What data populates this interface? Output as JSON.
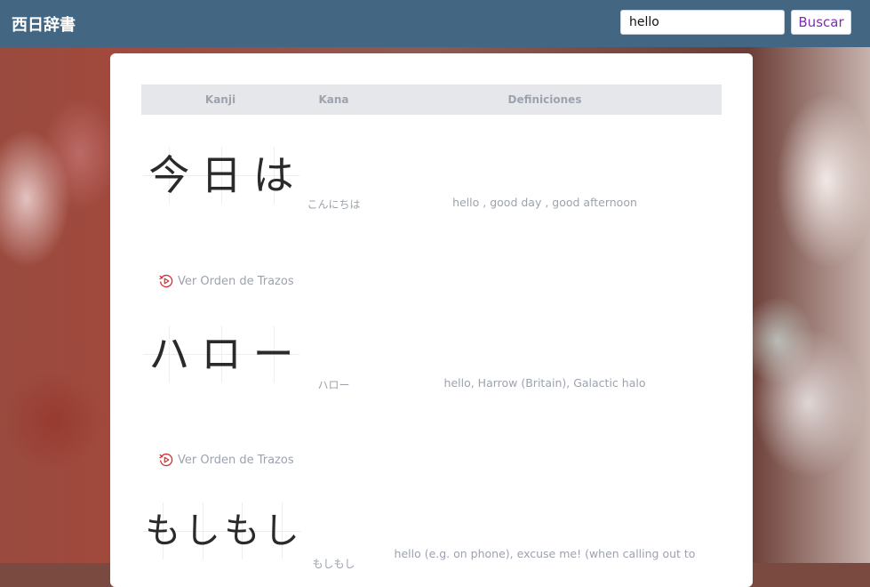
{
  "header": {
    "brand": "西日辞書",
    "search_value": "hello",
    "search_button": "Buscar"
  },
  "table": {
    "columns": [
      "Kanji",
      "Kana",
      "Definiciones"
    ],
    "rows": [
      {
        "kanji": [
          "今",
          "日",
          "は"
        ],
        "kana": "こんにちは",
        "definition": "hello , good day , good afternoon",
        "stroke_link": "Ver Orden de Trazos"
      },
      {
        "kanji": [
          "ハ",
          "ロ",
          "ー"
        ],
        "kana": "ハロー",
        "definition": "hello, Harrow (Britain), Galactic halo",
        "stroke_link": "Ver Orden de Trazos"
      },
      {
        "kanji": [
          "も",
          "し",
          "も",
          "し"
        ],
        "kana": "もしもし",
        "definition": "hello (e.g. on phone), excuse me! (when calling out to"
      }
    ]
  },
  "colors": {
    "topbar": "#436782",
    "button_text": "#7b2fb0",
    "muted_text": "#9ca3af",
    "header_row": "#e5e7eb",
    "stroke_icon": "#d32f2f"
  }
}
